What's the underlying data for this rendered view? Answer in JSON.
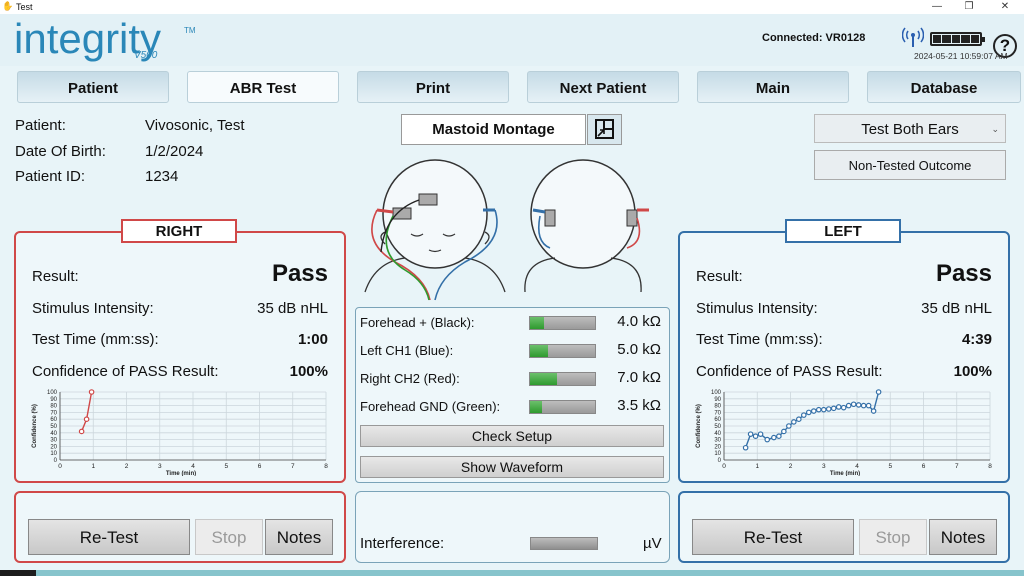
{
  "window": {
    "title": "Test",
    "minimize": "—",
    "restore": "❐",
    "close": "✕"
  },
  "header": {
    "logo": "integrity",
    "logo_tm": "TM",
    "logo_model": "V500",
    "connected": "Connected: VR0128",
    "datetime": "2024-05-21 10:59:07 AM",
    "help": "?"
  },
  "tabs": [
    "Patient",
    "ABR Test",
    "Print",
    "Next Patient",
    "Main",
    "Database"
  ],
  "patient": {
    "name_label": "Patient:",
    "name": "Vivosonic, Test",
    "dob_label": "Date Of Birth:",
    "dob": "1/2/2024",
    "id_label": "Patient ID:",
    "id": "1234"
  },
  "montage": {
    "label": "Mastoid Montage"
  },
  "controls": {
    "ears_select": "Test Both Ears",
    "non_tested": "Non-Tested Outcome"
  },
  "right": {
    "title": "RIGHT",
    "result_label": "Result:",
    "result": "Pass",
    "stim_label": "Stimulus Intensity:",
    "stim": "35 dB nHL",
    "time_label": "Test Time (mm:ss):",
    "time": "1:00",
    "conf_label": "Confidence of PASS Result:",
    "conf": "100%",
    "retest": "Re-Test",
    "stop": "Stop",
    "notes": "Notes"
  },
  "left": {
    "title": "LEFT",
    "result_label": "Result:",
    "result": "Pass",
    "stim_label": "Stimulus Intensity:",
    "stim": "35 dB nHL",
    "time_label": "Test Time (mm:ss):",
    "time": "4:39",
    "conf_label": "Confidence of PASS Result:",
    "conf": "100%",
    "retest": "Re-Test",
    "stop": "Stop",
    "notes": "Notes"
  },
  "impedance": {
    "rows": [
      {
        "label": "Forehead + (Black):",
        "value": "4.0 kΩ",
        "level": 0.22
      },
      {
        "label": "Left CH1 (Blue):",
        "value": "5.0 kΩ",
        "level": 0.28
      },
      {
        "label": "Right CH2 (Red):",
        "value": "7.0 kΩ",
        "level": 0.42
      },
      {
        "label": "Forehead GND (Green):",
        "value": "3.5 kΩ",
        "level": 0.18
      }
    ],
    "check_setup": "Check Setup",
    "show_waveform": "Show Waveform"
  },
  "interference": {
    "label": "Interference:",
    "unit": "µV"
  },
  "colors": {
    "right": "#d04848",
    "left": "#3470a8",
    "accent": "#2a87b8"
  },
  "chart_data": [
    {
      "type": "line",
      "xlabel": "Time (min)",
      "ylabel": "Confidence (%)",
      "xlim": [
        0,
        8
      ],
      "ylim": [
        0,
        100
      ],
      "xticks": [
        0,
        1,
        2,
        3,
        4,
        5,
        6,
        7,
        8
      ],
      "yticks": [
        0,
        10,
        20,
        30,
        40,
        50,
        60,
        70,
        80,
        90,
        100
      ],
      "series": [
        {
          "color": "#d04848",
          "x": [
            0.65,
            0.8,
            0.95
          ],
          "y": [
            42,
            60,
            100
          ]
        }
      ]
    },
    {
      "type": "line",
      "xlabel": "Time (min)",
      "ylabel": "Confidence (%)",
      "xlim": [
        0,
        8
      ],
      "ylim": [
        0,
        100
      ],
      "xticks": [
        0,
        1,
        2,
        3,
        4,
        5,
        6,
        7,
        8
      ],
      "yticks": [
        0,
        10,
        20,
        30,
        40,
        50,
        60,
        70,
        80,
        90,
        100
      ],
      "series": [
        {
          "color": "#3470a8",
          "x": [
            0.65,
            0.8,
            0.95,
            1.1,
            1.3,
            1.5,
            1.65,
            1.8,
            1.95,
            2.1,
            2.25,
            2.4,
            2.55,
            2.7,
            2.85,
            3.0,
            3.15,
            3.3,
            3.45,
            3.6,
            3.75,
            3.9,
            4.05,
            4.2,
            4.35,
            4.5,
            4.65
          ],
          "y": [
            18,
            38,
            35,
            38,
            30,
            33,
            35,
            42,
            50,
            56,
            60,
            66,
            70,
            72,
            74,
            74,
            75,
            76,
            78,
            77,
            80,
            82,
            81,
            80,
            80,
            72,
            100
          ]
        }
      ]
    }
  ]
}
